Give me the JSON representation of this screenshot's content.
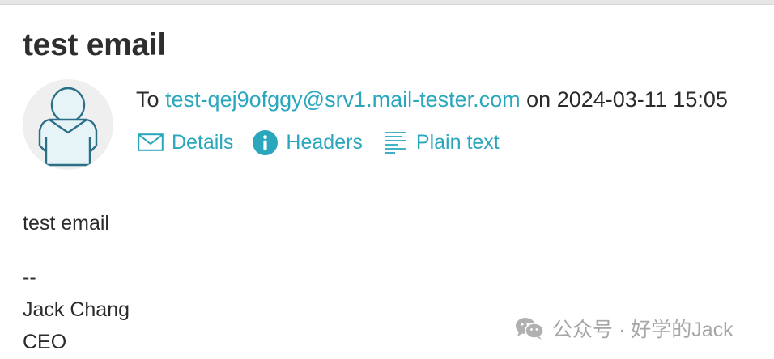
{
  "email": {
    "subject": "test email",
    "to_prefix": "To",
    "recipient": "test-qej9ofggy@srv1.mail-tester.com",
    "date_prefix": "on",
    "datetime": "2024-03-11 15:05"
  },
  "actions": {
    "details_label": "Details",
    "headers_label": "Headers",
    "plain_text_label": "Plain text"
  },
  "body": {
    "lines": [
      "test email",
      "--",
      "Jack Chang",
      "CEO"
    ]
  },
  "watermark": {
    "text": "公众号 · 好学的Jack"
  },
  "icons": {
    "avatar": "user-avatar-icon",
    "details": "envelope-icon",
    "headers": "info-icon",
    "plain_text": "text-lines-icon",
    "watermark": "wechat-icon"
  },
  "colors": {
    "link": "#2aa7bd",
    "text": "#2b2b2b",
    "avatar_bg": "#efefef",
    "watermark": "#a6a6a6"
  }
}
